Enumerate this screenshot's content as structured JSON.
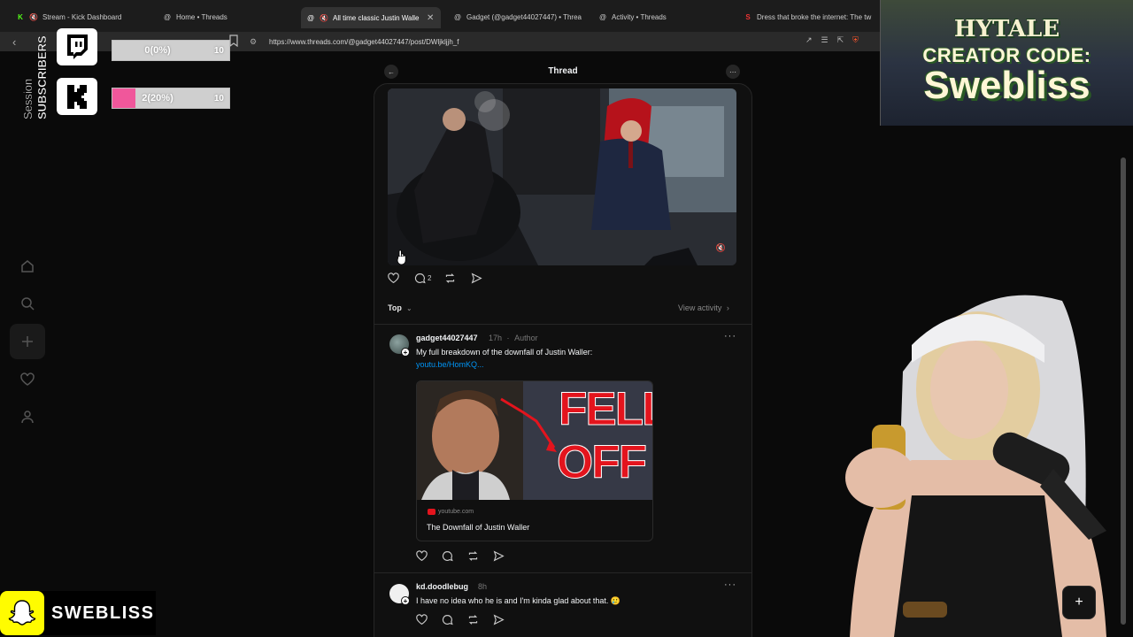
{
  "browser": {
    "tabs": [
      {
        "title": "Stream - Kick Dashboard",
        "favicon": "kick-icon",
        "active": false
      },
      {
        "title": "Home • Threads",
        "favicon": "threads-icon",
        "active": false
      },
      {
        "title": "All time classic Justin Waller",
        "favicon": "threads-icon",
        "active": true
      },
      {
        "title": "Gadget (@gadget44027447) • Threa",
        "favicon": "threads-icon",
        "active": false
      },
      {
        "title": "Activity • Threads",
        "favicon": "threads-icon",
        "active": false
      },
      {
        "title": "Dress that broke the internet: The tw",
        "favicon": "s-icon",
        "active": false
      }
    ],
    "url": "https://www.threads.com/@gadget44027447/post/DWljkljjh_f"
  },
  "overlay": {
    "vertical_label_1": "Session",
    "vertical_label_2": "SUBSCRIBERS",
    "twitch": {
      "value": "0(0%)",
      "goal": "10",
      "fraction": 0.0
    },
    "kick": {
      "value": "2(20%)",
      "goal": "10",
      "fraction": 0.2
    },
    "promo": {
      "line1": "HYTALE",
      "line2": "CREATOR CODE:",
      "line3": "Swebliss"
    },
    "snapchat_name": "SWEBLISS"
  },
  "thread": {
    "header_title": "Thread",
    "video_actions": {
      "comments": "2"
    },
    "sort_label": "Top",
    "view_activity": "View activity",
    "reply1": {
      "username": "gadget44027447",
      "time": "17h",
      "role": "Author",
      "text": "My full breakdown of the downfall of Justin Waller:",
      "link": "youtu.be/HomKQ...",
      "card": {
        "thumb_text_1": "FELL",
        "thumb_text_2": "OFF",
        "source": "youtube.com",
        "title": "The Downfall of Justin Waller"
      }
    },
    "reply2": {
      "username": "kd.doodlebug",
      "time": "8h",
      "text": "I have no idea who he is and I'm kinda glad about that. 🥲"
    }
  },
  "colors": {
    "accent_link": "#0095f6",
    "kick_fill": "#f0579b",
    "snap_yellow": "#fffc00"
  }
}
